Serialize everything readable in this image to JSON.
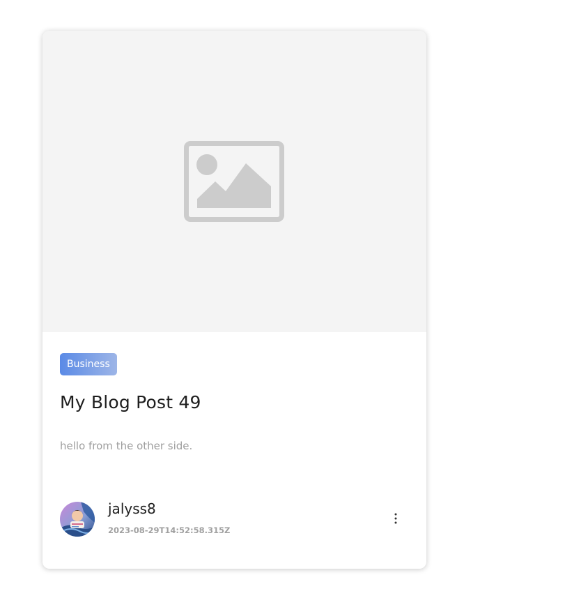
{
  "post": {
    "category": "Business",
    "title": "My Blog Post 49",
    "excerpt": "hello from the other side.",
    "author": "jalyss8",
    "date": "2023-08-29T14:52:58.315Z"
  },
  "icons": {
    "cover": "image-placeholder-icon",
    "menu": "more-vertical-icon"
  },
  "colors": {
    "badge_start": "#5a8ae6",
    "badge_end": "#9db5e7",
    "cover_bg": "#f4f4f4",
    "placeholder_icon": "#cccccc"
  }
}
